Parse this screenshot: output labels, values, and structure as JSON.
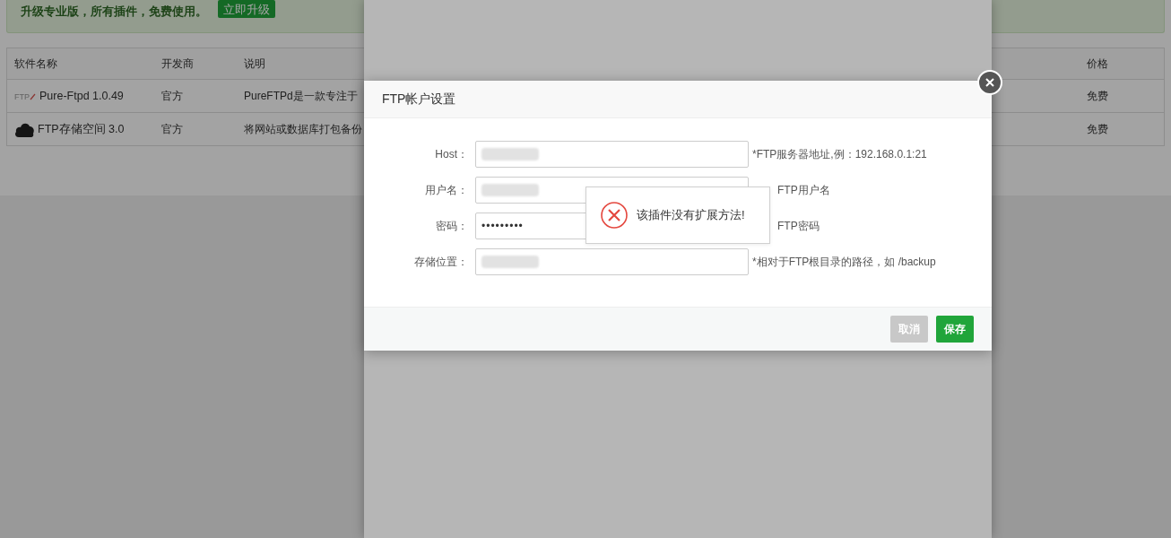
{
  "banner": {
    "text": "升级专业版，所有插件，免费使用。",
    "button": "立即升级"
  },
  "table": {
    "columns": [
      "软件名称",
      "开发商",
      "说明",
      "价格"
    ],
    "rows": [
      {
        "kind": "text-logo",
        "icon_text": "FTP",
        "name": "Pure-Ftpd 1.0.49",
        "developer": "官方",
        "description": "PureFTPd是一款专注于",
        "price": "免费"
      },
      {
        "kind": "cloud",
        "name": "FTP存储空间 3.0",
        "developer": "官方",
        "description": "将网站或数据库打包备份",
        "price": "免费"
      }
    ]
  },
  "dialog": {
    "title": "FTP帐户设置",
    "fields": [
      {
        "label": "Host：",
        "blurred": true,
        "hint": "*FTP服务器地址,例：192.168.0.1:21",
        "hint_covered": false
      },
      {
        "label": "用户名：",
        "blurred": true,
        "hint": "FTP用户名",
        "hint_covered": true
      },
      {
        "label": "密码：",
        "blurred": false,
        "value": "•••••••••",
        "hint": "FTP密码",
        "hint_covered": true
      },
      {
        "label": "存储位置：",
        "blurred": true,
        "hint": "*相对于FTP根目录的路径，如 /backup",
        "hint_covered": false
      }
    ],
    "buttons": [
      {
        "label": "取消",
        "kind": "cancel"
      },
      {
        "label": "保存",
        "kind": "primary"
      }
    ]
  },
  "toast": {
    "kind": "error",
    "text": "该插件没有扩展方法!"
  }
}
